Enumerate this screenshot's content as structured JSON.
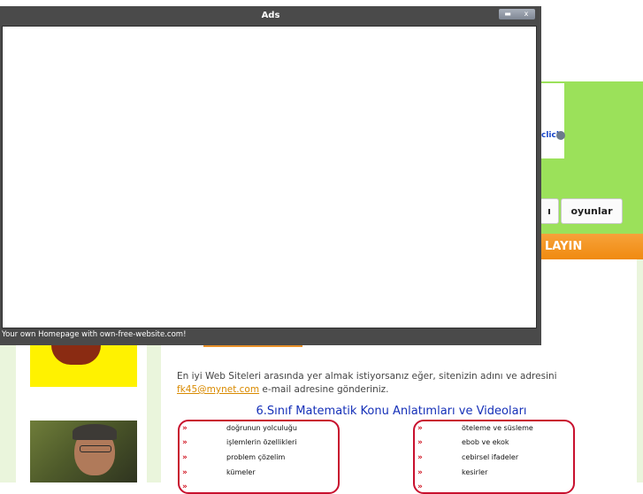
{
  "ads_window": {
    "title": "Ads",
    "minimize_glyph": "▬",
    "close_glyph": "x",
    "footer": "Your own Homepage with own-free-website.com!"
  },
  "header": {
    "adchoice_text": "click",
    "nav": {
      "partial_label": "ı",
      "oyunlar_label": "oyunlar"
    },
    "banner_text": "LAYIN"
  },
  "content": {
    "intro_before": "En iyi Web Siteleri arasında yer almak istiyorsanız eğer, sitenizin adını ve adresini ",
    "intro_link": "fk45@mynet.com",
    "intro_after": "  e-mail adresine gönderiniz.",
    "section_title": "6.Sınıf Matematik Konu Anlatımları ve Videoları",
    "left_topics": [
      "doğrunun yolculuğu",
      "işlemlerin özellikleri",
      "problem çözelim",
      "kümeler",
      ""
    ],
    "right_topics": [
      "öteleme ve süsleme",
      "ebob ve ekok",
      "cebirsel ifadeler",
      "kesirler",
      ""
    ],
    "bullet_glyph": "»"
  },
  "colors": {
    "green": "#9be15a",
    "orange": "#f08a10",
    "title_blue": "#1530b8",
    "box_red": "#c8102e"
  }
}
